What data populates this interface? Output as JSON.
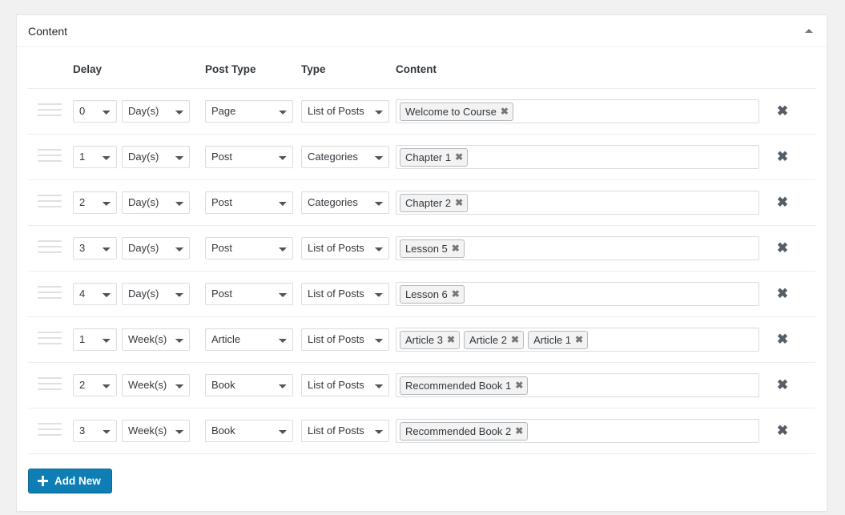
{
  "panel": {
    "title": "Content",
    "toggle_icon": "caret-up-icon"
  },
  "table": {
    "headers": {
      "handle": "",
      "delay": "Delay",
      "post_type": "Post Type",
      "type": "Type",
      "content": "Content",
      "delete": ""
    },
    "rows": [
      {
        "delay": "0",
        "unit": "Day(s)",
        "post_type": "Page",
        "type": "List of Posts",
        "tags": [
          "Welcome to Course"
        ]
      },
      {
        "delay": "1",
        "unit": "Day(s)",
        "post_type": "Post",
        "type": "Categories",
        "tags": [
          "Chapter 1"
        ]
      },
      {
        "delay": "2",
        "unit": "Day(s)",
        "post_type": "Post",
        "type": "Categories",
        "tags": [
          "Chapter 2"
        ]
      },
      {
        "delay": "3",
        "unit": "Day(s)",
        "post_type": "Post",
        "type": "List of Posts",
        "tags": [
          "Lesson 5"
        ]
      },
      {
        "delay": "4",
        "unit": "Day(s)",
        "post_type": "Post",
        "type": "List of Posts",
        "tags": [
          "Lesson 6"
        ]
      },
      {
        "delay": "1",
        "unit": "Week(s)",
        "post_type": "Article",
        "type": "List of Posts",
        "tags": [
          "Article 3",
          "Article 2",
          "Article 1"
        ]
      },
      {
        "delay": "2",
        "unit": "Week(s)",
        "post_type": "Book",
        "type": "List of Posts",
        "tags": [
          "Recommended Book 1"
        ]
      },
      {
        "delay": "3",
        "unit": "Week(s)",
        "post_type": "Book",
        "type": "List of Posts",
        "tags": [
          "Recommended Book 2"
        ]
      }
    ],
    "tag_remove_glyph": "✖",
    "row_delete_glyph": "✖",
    "drag_handle_icon": "drag-handle-icon"
  },
  "options": {
    "delay": [
      "0",
      "1",
      "2",
      "3",
      "4"
    ],
    "unit": [
      "Day(s)",
      "Week(s)"
    ],
    "post_type": [
      "Page",
      "Post",
      "Article",
      "Book"
    ],
    "type": [
      "List of Posts",
      "Categories"
    ]
  },
  "footer": {
    "add_label": "Add New",
    "add_icon": "plus-icon"
  },
  "colors": {
    "accent": "#0e7eb4",
    "page_bg": "#f1f1f1",
    "panel_border": "#e5e5e5",
    "text": "#32373c"
  }
}
